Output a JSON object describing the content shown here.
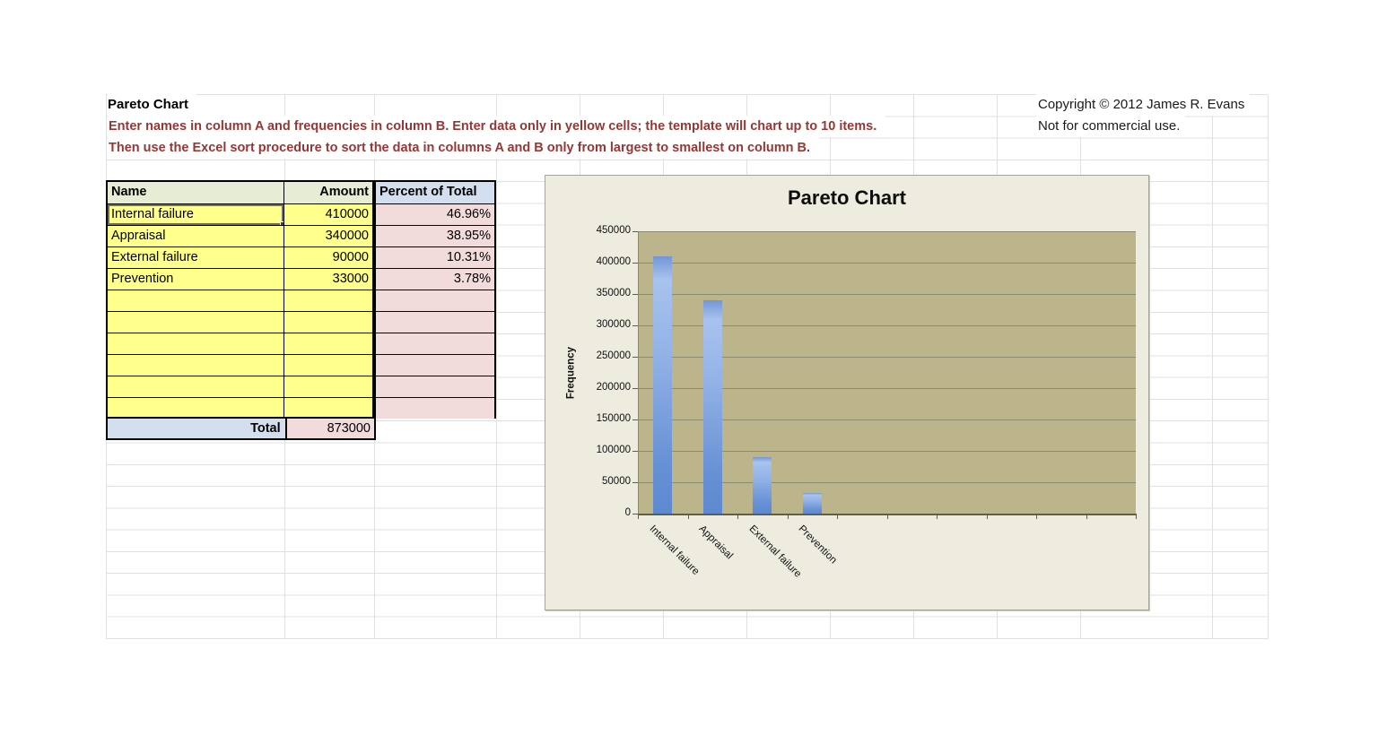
{
  "sheet": {
    "title": "Pareto Chart",
    "instructions_line1": "Enter names in column A and frequencies in column B.  Enter data only in yellow cells; the template will chart up to 10 items.",
    "instructions_line2": "Then use the Excel sort procedure to sort the data in columns A and B only from largest to smallest on column B.",
    "copyright_line1": "Copyright © 2012 James R. Evans",
    "copyright_line2": "Not for commercial use.",
    "colors": {
      "instruction_text": "#953735",
      "cell_yellow": "#FFFF8C",
      "cell_pink": "#F2DCDB",
      "header_green": "#E7EDD5",
      "header_blue": "#D3DFEE",
      "sheet_gridline": "#DDE1E4"
    }
  },
  "table": {
    "headers": {
      "name": "Name",
      "amount": "Amount",
      "percent": "Percent of Total"
    },
    "rows": [
      {
        "name": "Internal failure",
        "amount": "410000",
        "percent": "46.96%"
      },
      {
        "name": "Appraisal",
        "amount": "340000",
        "percent": "38.95%"
      },
      {
        "name": "External failure",
        "amount": "90000",
        "percent": "10.31%"
      },
      {
        "name": "Prevention",
        "amount": "33000",
        "percent": "3.78%"
      },
      {
        "name": "",
        "amount": "",
        "percent": ""
      },
      {
        "name": "",
        "amount": "",
        "percent": ""
      },
      {
        "name": "",
        "amount": "",
        "percent": ""
      },
      {
        "name": "",
        "amount": "",
        "percent": ""
      },
      {
        "name": "",
        "amount": "",
        "percent": ""
      },
      {
        "name": "",
        "amount": "",
        "percent": ""
      }
    ],
    "total_label": "Total",
    "total_value": "873000"
  },
  "chart_data": {
    "type": "bar",
    "title": "Pareto Chart",
    "ylabel": "Frequency",
    "xlabel": "",
    "categories": [
      "Internal failure",
      "Appraisal",
      "External failure",
      "Prevention"
    ],
    "values": [
      410000,
      340000,
      90000,
      33000
    ],
    "num_category_slots": 10,
    "ylim": [
      0,
      450000
    ],
    "ytick_step": 50000,
    "ytick_labels": [
      "450000",
      "400000",
      "350000",
      "300000",
      "250000",
      "200000",
      "150000",
      "100000",
      "50000",
      "0"
    ],
    "grid": true,
    "legend": false,
    "colors": {
      "chart_bg": "#EDECDF",
      "plot_bg": "#BCB58B",
      "plot_gridline": "#8B8B71",
      "bar_fill_top": "#A9C2EE",
      "bar_fill_bottom": "#5D89D0"
    }
  }
}
